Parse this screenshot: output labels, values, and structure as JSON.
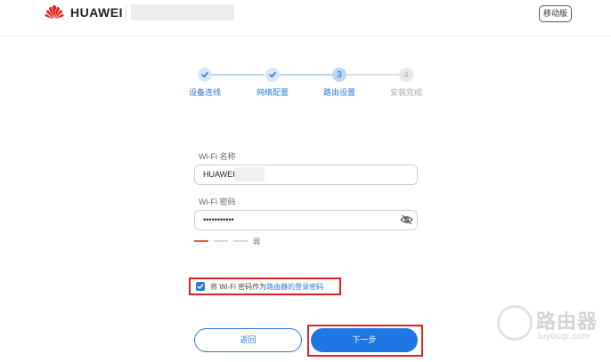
{
  "header": {
    "brand": "HUAWEI",
    "mobile_button": "移动版"
  },
  "steps": [
    {
      "label": "设备连线",
      "state": "done",
      "number": ""
    },
    {
      "label": "网络配置",
      "state": "done",
      "number": ""
    },
    {
      "label": "路由设置",
      "state": "current",
      "number": "3"
    },
    {
      "label": "安装完成",
      "state": "pending",
      "number": "4"
    }
  ],
  "form": {
    "ssid_label": "Wi-Fi 名称",
    "ssid_value": "HUAWEI",
    "password_label": "Wi-Fi 密码",
    "password_value": "•••••••••••",
    "strength_label": "弱",
    "strength_level": "1 of 3",
    "checkbox_prefix": "将 Wi-Fi 密码作为",
    "checkbox_link": "路由器的登录密码",
    "checkbox_checked": true
  },
  "buttons": {
    "back": "返回",
    "next": "下一步"
  },
  "watermark": {
    "text": "路由器",
    "url": "luyouqi.com"
  },
  "colors": {
    "accent": "#1e77e3",
    "highlight_box": "#e02020",
    "strength_weak": "#f06030"
  }
}
